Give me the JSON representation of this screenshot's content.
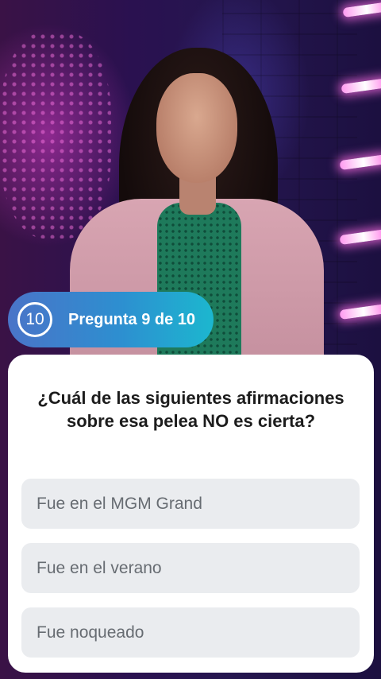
{
  "counter": {
    "timer_value": "10",
    "label": "Pregunta 9 de 10"
  },
  "question": {
    "text": "¿Cuál de las siguientes afirmaciones sobre esa pelea NO es cierta?"
  },
  "options": [
    {
      "label": "Fue en el MGM Grand"
    },
    {
      "label": "Fue en el verano"
    },
    {
      "label": "Fue noqueado"
    }
  ],
  "colors": {
    "pill_start": "#4a74c8",
    "pill_end": "#1cb7cf",
    "card_bg": "#ffffff",
    "option_bg": "#eaecef",
    "option_text": "#676c72"
  }
}
